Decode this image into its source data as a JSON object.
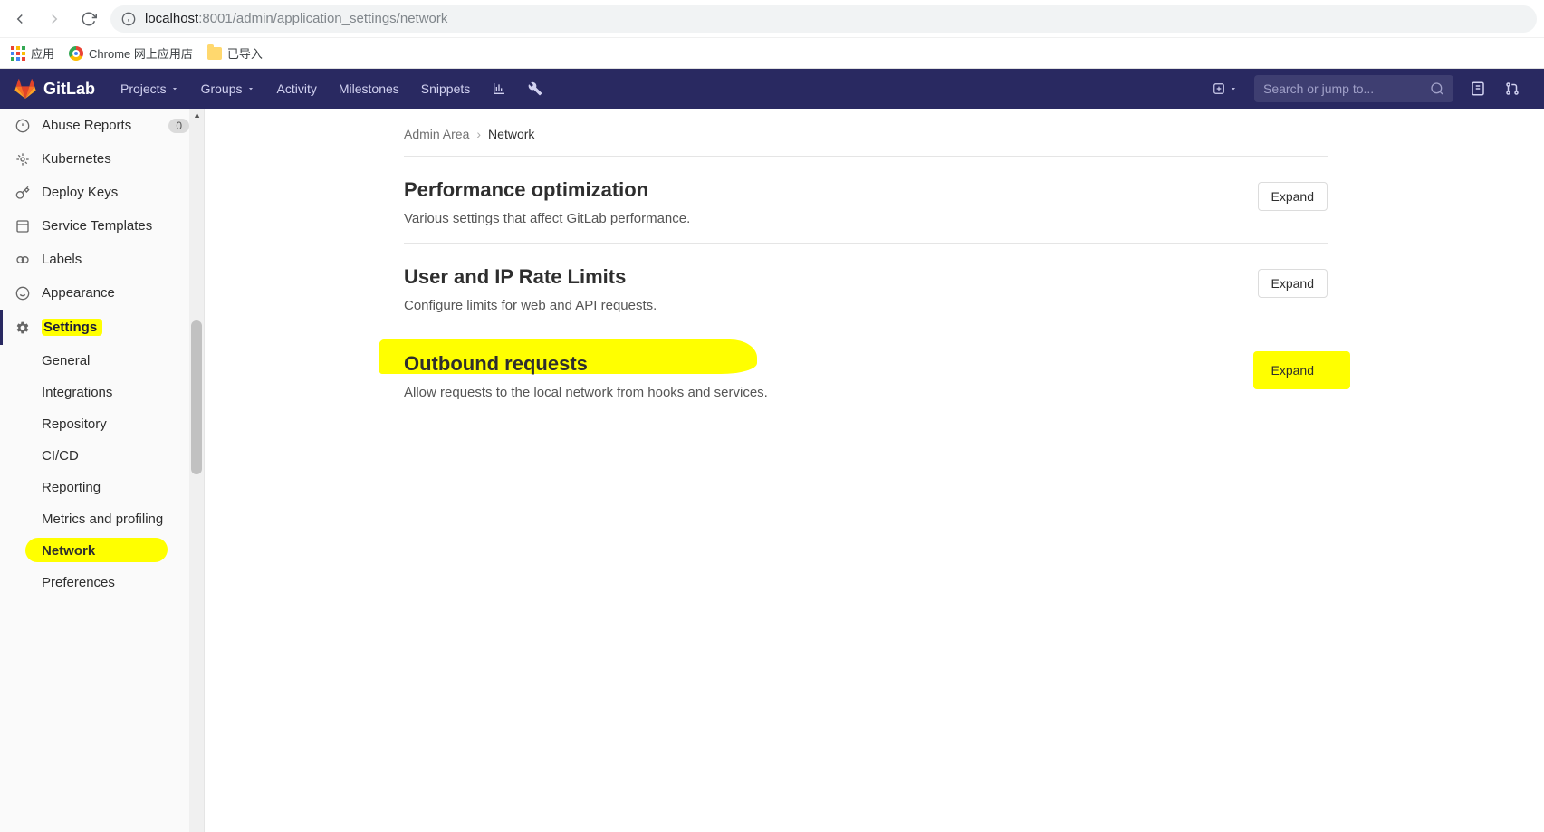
{
  "browser": {
    "url_host": "localhost",
    "url_path": ":8001/admin/application_settings/network",
    "bookmarks": {
      "apps": "应用",
      "webstore": "Chrome 网上应用店",
      "imported": "已导入"
    }
  },
  "navbar": {
    "brand": "GitLab",
    "items": {
      "projects": "Projects",
      "groups": "Groups",
      "activity": "Activity",
      "milestones": "Milestones",
      "snippets": "Snippets"
    },
    "search_placeholder": "Search or jump to..."
  },
  "sidebar": {
    "abuse": {
      "label": "Abuse Reports",
      "badge": "0"
    },
    "kubernetes": "Kubernetes",
    "deploy_keys": "Deploy Keys",
    "service_templates": "Service Templates",
    "labels": "Labels",
    "appearance": "Appearance",
    "settings": "Settings",
    "sub": {
      "general": "General",
      "integrations": "Integrations",
      "repository": "Repository",
      "cicd": "CI/CD",
      "reporting": "Reporting",
      "metrics": "Metrics and profiling",
      "network": "Network",
      "preferences": "Preferences"
    }
  },
  "breadcrumb": {
    "root": "Admin Area",
    "current": "Network"
  },
  "sections": {
    "perf": {
      "title": "Performance optimization",
      "desc": "Various settings that affect GitLab performance.",
      "btn": "Expand"
    },
    "rate": {
      "title": "User and IP Rate Limits",
      "desc": "Configure limits for web and API requests.",
      "btn": "Expand"
    },
    "outbound": {
      "title": "Outbound requests",
      "desc": "Allow requests to the local network from hooks and services.",
      "btn": "Expand"
    }
  }
}
